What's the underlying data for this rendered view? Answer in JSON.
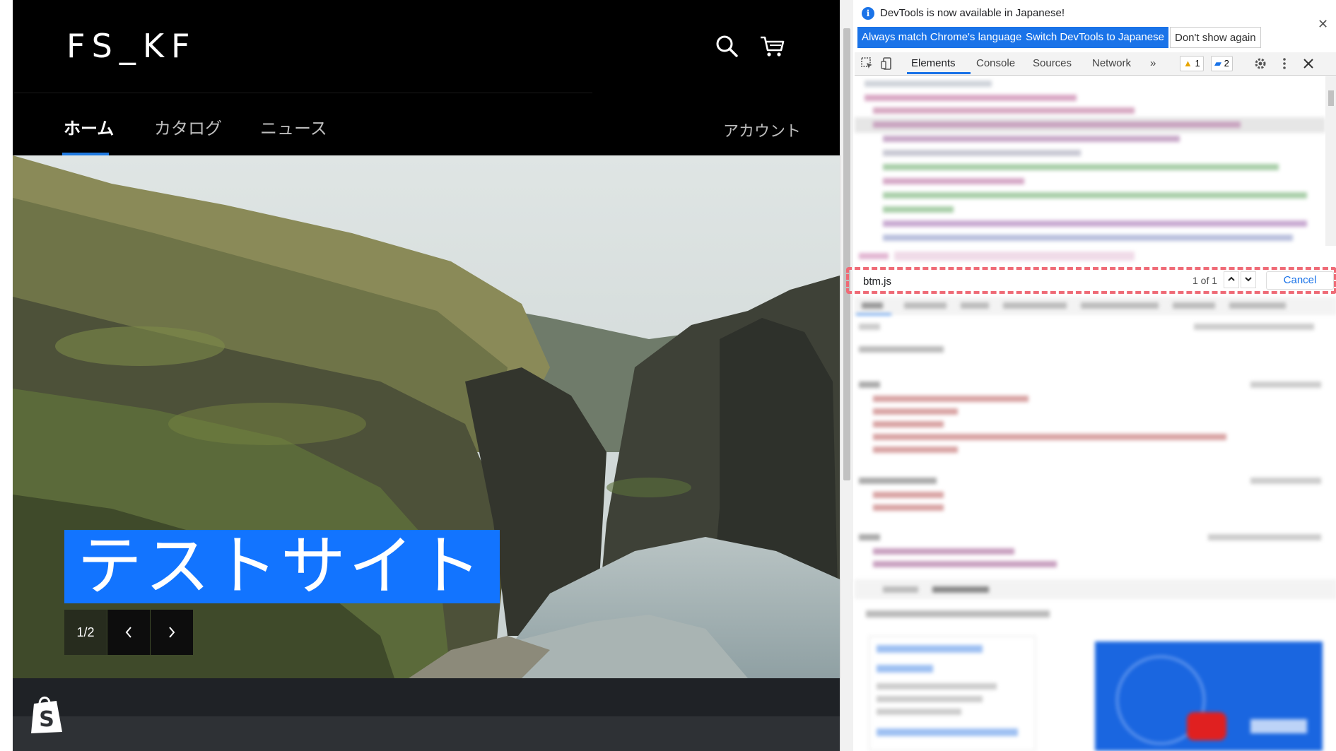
{
  "site": {
    "logo": "FS_KF",
    "nav": [
      {
        "label": "ホーム",
        "active": true
      },
      {
        "label": "カタログ",
        "active": false
      },
      {
        "label": "ニュース",
        "active": false
      }
    ],
    "account_label": "アカウント",
    "hero": {
      "title": "テストサイト",
      "slide_counter": "1/2",
      "prev_icon": "chevron-left-icon",
      "next_icon": "chevron-right-icon"
    },
    "icons": {
      "search": "search-icon",
      "cart": "cart-icon",
      "badge": "shopify-icon"
    },
    "colors": {
      "accent": "#1274ff",
      "nav_underline": "#1f7ae0",
      "header_bg": "#000000"
    }
  },
  "devtools": {
    "infobar": {
      "message": "DevTools is now available in Japanese!",
      "buttons": [
        "Always match Chrome's language",
        "Switch DevTools to Japanese",
        "Don't show again"
      ]
    },
    "tabs": [
      "Elements",
      "Console",
      "Sources",
      "Network"
    ],
    "more_tabs": "»",
    "warnings_count": "1",
    "messages_count": "2",
    "search": {
      "value": "btm.js",
      "result_count": "1 of 1",
      "cancel_label": "Cancel"
    },
    "colors": {
      "primary": "#1a73e8",
      "highlight_dash": "#ef6a76"
    }
  }
}
